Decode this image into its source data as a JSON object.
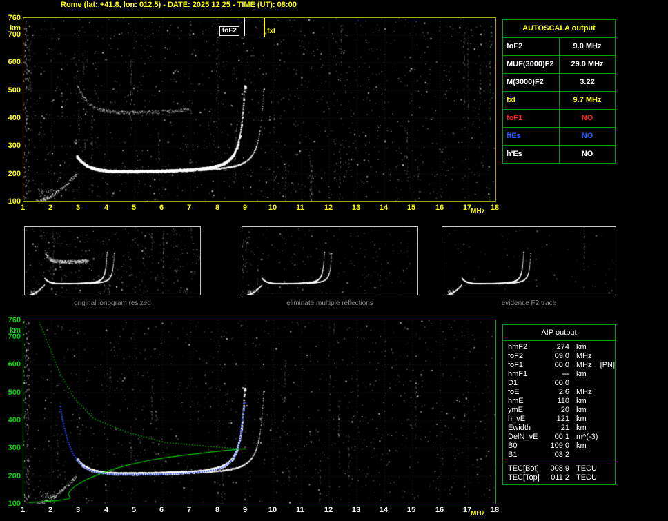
{
  "title": "Rome (lat: +41.8, lon: 012.5) - DATE: 2025 12 25 - TIME (UT): 08:00",
  "colors": {
    "accent_yellow": "#ffff00",
    "plot_border_top": "#a8a800",
    "plot_border_bottom": "#00a800",
    "table_border": "#00a000",
    "profile_green": "#00cc00",
    "fit_blue": "#2b4bff",
    "status_red": "#ff2222",
    "status_blue": "#1e5bff",
    "white": "#ffffff",
    "caption_gray": "#8c8c8c",
    "y_label_bottom": "#00dd00",
    "x_label_bottom": "#ffffff"
  },
  "axes": {
    "xmin": 1,
    "xmax": 18,
    "x_ticks": [
      "1",
      "2",
      "3",
      "4",
      "5",
      "6",
      "7",
      "8",
      "9",
      "10",
      "11",
      "12",
      "13",
      "14",
      "15",
      "16",
      "17",
      "18"
    ],
    "x_unit": "MHz",
    "ymin": 100,
    "ymax": 760,
    "y_ticks": [
      "760",
      "700",
      "600",
      "500",
      "400",
      "300",
      "200",
      "100"
    ],
    "y_unit": "km"
  },
  "markers": {
    "foF2": {
      "label": "foF2",
      "mhz": 9.0
    },
    "fxI": {
      "label": "fxI",
      "mhz": 9.7
    }
  },
  "ionogram_model": {
    "foF2": 9.0,
    "fxI": 9.7,
    "hmF2": 274,
    "foE": 2.6,
    "hmE": 110,
    "base_virtual_height": 210
  },
  "profile": {
    "topside": [
      [
        1.55,
        755
      ],
      [
        1.9,
        670
      ],
      [
        2.3,
        570
      ],
      [
        2.8,
        483
      ],
      [
        3.5,
        409
      ],
      [
        4.7,
        359
      ],
      [
        6.1,
        322
      ],
      [
        7.6,
        308
      ],
      [
        9.0,
        298
      ]
    ],
    "bottomside": [
      [
        9.0,
        298
      ],
      [
        8.1,
        290
      ],
      [
        7.1,
        278
      ],
      [
        6.1,
        266
      ],
      [
        5.1,
        248
      ],
      [
        4.2,
        224
      ],
      [
        3.4,
        194
      ],
      [
        2.9,
        167
      ],
      [
        2.66,
        145
      ],
      [
        2.6,
        130
      ],
      [
        2.72,
        122
      ],
      [
        2.5,
        114
      ],
      [
        1.9,
        109
      ],
      [
        1.2,
        104
      ]
    ]
  },
  "thumbnails": [
    {
      "caption": "original ionogram resized"
    },
    {
      "caption": "eliminate multiple reflections"
    },
    {
      "caption": "evidence F2 trace"
    }
  ],
  "autoscala_table": {
    "title": "AUTOSCALA output",
    "rows": [
      {
        "label": "foF2",
        "value": "9.0 MHz",
        "color": "#ffffff"
      },
      {
        "label": "MUF(3000)F2",
        "value": "29.0 MHz",
        "color": "#ffffff"
      },
      {
        "label": "M(3000)F2",
        "value": "3.22",
        "color": "#ffffff"
      },
      {
        "label": "fxI",
        "value": "9.7 MHz",
        "color": "#ffff00"
      },
      {
        "label": "foF1",
        "value": "NO",
        "color": "#ff2222"
      },
      {
        "label": "ftEs",
        "value": "NO",
        "color": "#1e5bff"
      },
      {
        "label": "h'Es",
        "value": "NO",
        "color": "#ffffff"
      }
    ]
  },
  "aip_table": {
    "title": "AIP output",
    "rows": [
      {
        "label": "hmF2",
        "value": "274",
        "unit": "km"
      },
      {
        "label": "foF2",
        "value": "09.0",
        "unit": "MHz"
      },
      {
        "label": "foF1",
        "value": "00.0",
        "unit": "MHz",
        "note": "[PN]"
      },
      {
        "label": "hmF1",
        "value": "---",
        "unit": "km"
      },
      {
        "label": "D1",
        "value": "00.0",
        "unit": ""
      },
      {
        "label": "foE",
        "value": "2.6",
        "unit": "MHz"
      },
      {
        "label": "hmE",
        "value": "110",
        "unit": "km"
      },
      {
        "label": "ymE",
        "value": "20",
        "unit": "km"
      },
      {
        "label": "h_vE",
        "value": "121",
        "unit": "km"
      },
      {
        "label": "Ewidth",
        "value": "21",
        "unit": "km"
      },
      {
        "label": "DelN_vE",
        "value": "00.1",
        "unit": "m^(-3)"
      },
      {
        "label": "B0",
        "value": "109.0",
        "unit": "km"
      },
      {
        "label": "B1",
        "value": "03.2",
        "unit": ""
      }
    ],
    "tec_rows": [
      {
        "label": "TEC[Bot]",
        "value": "008.9",
        "unit": "TECU"
      },
      {
        "label": "TEC[Top]",
        "value": "011.2",
        "unit": "TECU"
      }
    ]
  }
}
